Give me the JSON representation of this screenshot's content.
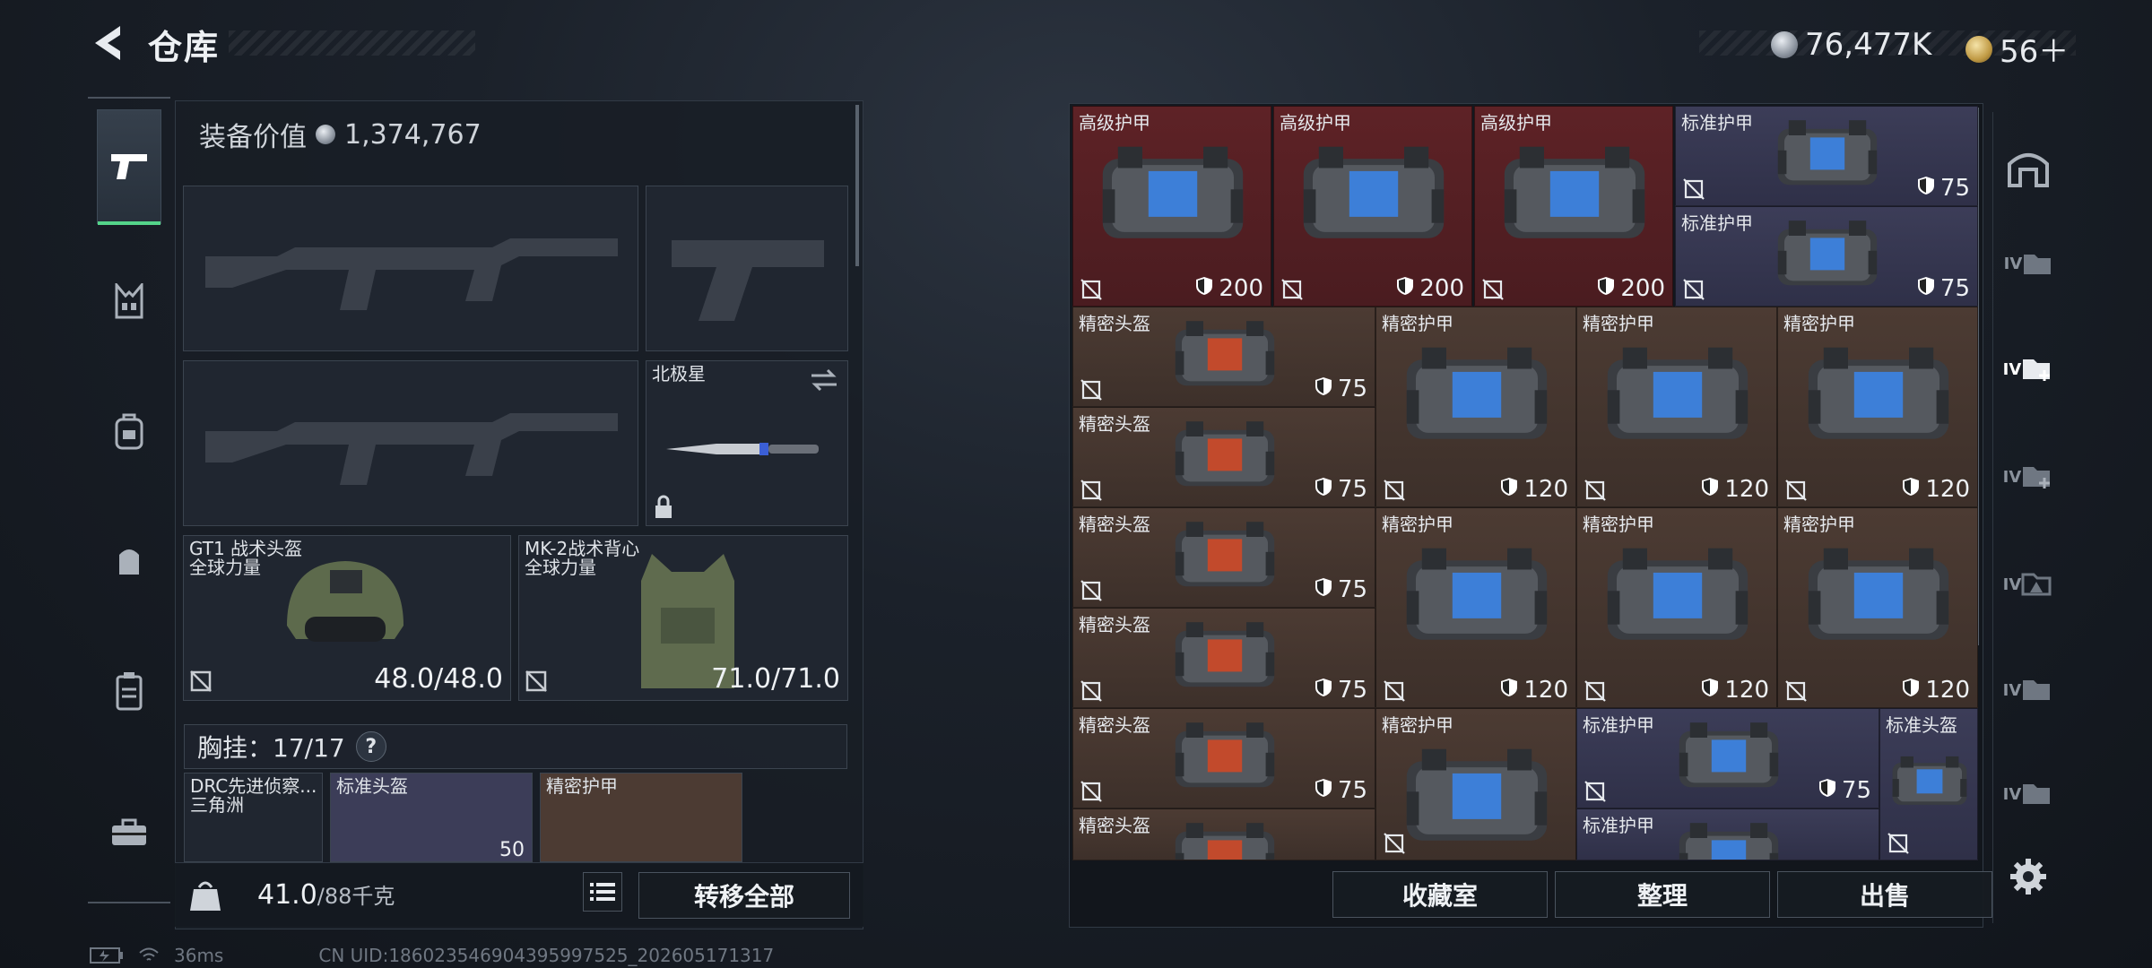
{
  "header": {
    "title": "仓库",
    "silver": "76,477K",
    "gold": "56＋"
  },
  "sidenav": {
    "icons": [
      "pistol-icon",
      "vest-icon",
      "backpack-icon",
      "pouch-icon",
      "case-icon",
      "toolbox-icon"
    ]
  },
  "loadout": {
    "equip_value_label": "装备价值",
    "equip_value": "1,374,767",
    "melee_label": "北极星",
    "helmet": {
      "name": "GT1 战术头盔",
      "brand": "全球力量",
      "durability": "48.0/48.0"
    },
    "vest": {
      "name": "MK-2战术背心",
      "brand": "全球力量",
      "durability": "71.0/71.0"
    },
    "chest_rig_label": "胸挂：17/17",
    "chest_items": [
      {
        "name": "DRC先进侦察...",
        "sub": "三角洲"
      },
      {
        "name": "标准头盔",
        "armor": "50"
      },
      {
        "name": "精密护甲"
      }
    ],
    "weight": "41.0",
    "weight_max": "/88千克",
    "transfer_all": "转移全部"
  },
  "grid": {
    "items": [
      {
        "name": "高级护甲",
        "armor": "200",
        "color": "red"
      },
      {
        "name": "高级护甲",
        "armor": "200",
        "color": "red"
      },
      {
        "name": "高级护甲",
        "armor": "200",
        "color": "red"
      },
      {
        "name": "标准护甲",
        "armor": "75",
        "color": "blu"
      },
      {
        "name": "标准护甲",
        "armor": "75",
        "color": "blu"
      },
      {
        "name": "精密头盔",
        "armor": "75",
        "color": "brn"
      },
      {
        "name": "精密护甲",
        "armor": "120",
        "color": "brn"
      },
      {
        "name": "精密护甲",
        "armor": "120",
        "color": "brn"
      },
      {
        "name": "精密护甲",
        "armor": "120",
        "color": "brn"
      },
      {
        "name": "精密头盔",
        "armor": "75",
        "color": "brn"
      },
      {
        "name": "精密头盔",
        "armor": "75",
        "color": "brn"
      },
      {
        "name": "精密护甲",
        "armor": "120",
        "color": "brn"
      },
      {
        "name": "精密护甲",
        "armor": "120",
        "color": "brn"
      },
      {
        "name": "精密护甲",
        "armor": "120",
        "color": "brn"
      },
      {
        "name": "精密头盔",
        "armor": "75",
        "color": "brn"
      },
      {
        "name": "精密头盔",
        "armor": "75",
        "color": "brn"
      },
      {
        "name": "精密护甲",
        "armor": "",
        "color": "brn"
      },
      {
        "name": "标准护甲",
        "armor": "75",
        "color": "blu"
      },
      {
        "name": "标准头盔",
        "armor": "",
        "color": "blu"
      },
      {
        "name": "精密头盔",
        "armor": "",
        "color": "brn"
      },
      {
        "name": "标准护甲",
        "armor": "",
        "color": "blu"
      }
    ],
    "btn_collection": "收藏室",
    "btn_sort": "整理",
    "btn_sell": "出售"
  },
  "rightnav": {
    "labels": [
      "IV",
      "IV",
      "IV",
      "IV",
      "IV",
      "IV"
    ]
  },
  "status": {
    "ping": "36ms",
    "uid": "CN UID:1860235469043959975​25_202605171317"
  },
  "colors": {
    "accent_green": "#54d48a",
    "red_cell": "#5e2226",
    "brown_cell": "#4c3b33",
    "blue_cell": "#3c3d58"
  }
}
